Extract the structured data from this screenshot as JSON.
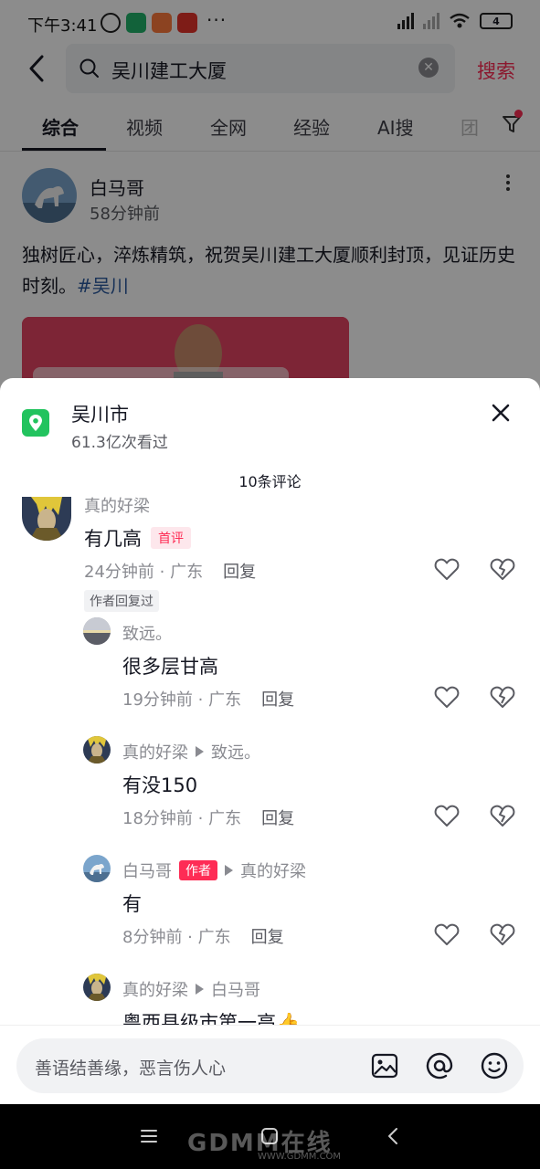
{
  "status_bar": {
    "time": "下午3:41",
    "dots": "···",
    "battery": "4"
  },
  "search": {
    "query": "吴川建工大厦",
    "search_button": "搜索"
  },
  "tabs": [
    {
      "label": "综合",
      "active": true
    },
    {
      "label": "视频"
    },
    {
      "label": "全网"
    },
    {
      "label": "经验"
    },
    {
      "label": "AI搜"
    },
    {
      "label": "团"
    }
  ],
  "post": {
    "username": "白马哥",
    "time_ago": "58分钟前",
    "text": "独树匠心，淬炼精筑，祝贺吴川建工大厦顺利封顶，见证历史时刻。",
    "hashtag": "#吴川"
  },
  "location_sheet": {
    "name": "吴川市",
    "views": "61.3亿次看过",
    "comment_count": "10条评论"
  },
  "comments": [
    {
      "user": "真的好梁",
      "text": "有几高",
      "badge": "首评",
      "time": "24分钟前",
      "region": "广东",
      "reply": "回复",
      "author_replied": "作者回复过"
    },
    {
      "user": "致远。",
      "text": "很多层甘高",
      "time": "19分钟前",
      "region": "广东",
      "reply": "回复"
    },
    {
      "user": "真的好梁",
      "reply_to": "致远。",
      "text": "有没150",
      "time": "18分钟前",
      "region": "广东",
      "reply": "回复"
    },
    {
      "user": "白马哥",
      "badge": "作者",
      "reply_to": "真的好梁",
      "text": "有",
      "time": "8分钟前",
      "region": "广东",
      "reply": "回复"
    },
    {
      "user": "真的好梁",
      "reply_to": "白马哥",
      "text": "粤西县级市第一高👍"
    }
  ],
  "input": {
    "placeholder": "善语结善缘，恶言伤人心"
  },
  "watermark": {
    "text": "GDMM在线",
    "url": "WWW.GDMM.COM"
  },
  "colors": {
    "accent": "#fe2c55",
    "location_green": "#22c35e",
    "hashtag_blue": "#2b5a9e"
  }
}
